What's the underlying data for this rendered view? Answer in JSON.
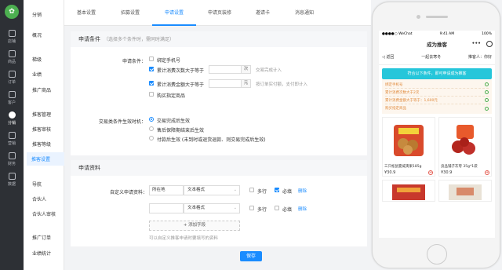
{
  "rail": {
    "items": [
      {
        "icon": "shop-icon",
        "label": "店铺"
      },
      {
        "icon": "goods-icon",
        "label": "商品"
      },
      {
        "icon": "order-icon",
        "label": "订单"
      },
      {
        "icon": "customer-icon",
        "label": "客户"
      },
      {
        "icon": "distribution-icon",
        "label": "分销"
      },
      {
        "icon": "marketing-icon",
        "label": "营销"
      },
      {
        "icon": "finance-icon",
        "label": "财务"
      },
      {
        "icon": "data-icon",
        "label": "数据"
      }
    ]
  },
  "sub": {
    "title": "分销",
    "items": [
      "概况",
      "梯级",
      "业绩",
      "推广商品",
      "推客管理",
      "推客审核",
      "推客等级",
      "推客设置",
      "导航",
      "合伙人",
      "合伙人审核",
      "推广订单",
      "业绩统计"
    ]
  },
  "tabs": [
    "基本设置",
    "招募设置",
    "申请设置",
    "申请页装修",
    "邀请卡",
    "消息通知"
  ],
  "apply_cond": {
    "title": "申请条件",
    "hint": "（选择多个条件时，需同时满足）",
    "label": "申请条件：",
    "options": [
      {
        "label": "绑定手机号",
        "checked": false
      },
      {
        "label": "累计消费次数大于等于",
        "checked": true,
        "unit": "次",
        "hint": "交易完成计入"
      },
      {
        "label": "累计消费金额大于等于",
        "checked": true,
        "unit": "元",
        "hint": "按订单实付额，支付即计入"
      },
      {
        "label": "购买指定商品",
        "checked": false
      }
    ],
    "timing_label": "交易类条件生效时机：",
    "timing_options": [
      {
        "label": "交易完成后生效",
        "on": true
      },
      {
        "label": "售后保障期结束后生效",
        "on": false
      },
      {
        "label": "付款后生效 (未到时或退货退款、则交易完成后生效)",
        "on": false
      }
    ]
  },
  "apply_info": {
    "title": "申请资料",
    "label": "自定义申请资料：",
    "rows": [
      {
        "name": "所在地",
        "type": "文本格式",
        "multi_line": "多行",
        "required": "必填",
        "required_checked": true,
        "delete": "删除"
      },
      {
        "name": "",
        "type": "文本格式",
        "multi_line": "多行",
        "required": "必填",
        "required_checked": false,
        "delete": "删除"
      }
    ],
    "add_label": "+ 添加字段",
    "note": "可以自定义推客申请时要填写的资料"
  },
  "save_label": "保存",
  "phone": {
    "carrier": "●●●●○ WeChat",
    "time": "9:41 AM",
    "battery": "100%",
    "title": "成为推客",
    "more": "•••",
    "back": "◁ 返回",
    "user": "一起去寒冬",
    "in_label": "推客人：你好",
    "banner": "符合以下条件，即可申请成为推客",
    "conds": [
      {
        "label": "绑定手机号"
      },
      {
        "label": "累计消费次数大于2次"
      },
      {
        "label": "累计消费金额大于等于：1,600元"
      },
      {
        "label": "购买指定商品"
      }
    ],
    "goods": [
      {
        "name": "三只松鼠夏威夷果185g",
        "price": "¥30.9"
      },
      {
        "name": "良品铺子灰枣 35g*1袋",
        "price": "¥30.9"
      },
      {
        "name": "",
        "price": ""
      },
      {
        "name": "",
        "price": ""
      }
    ]
  },
  "colors": {
    "accent": "#1a8cff",
    "rail": "#2d3035",
    "teal": "#26c6da"
  }
}
